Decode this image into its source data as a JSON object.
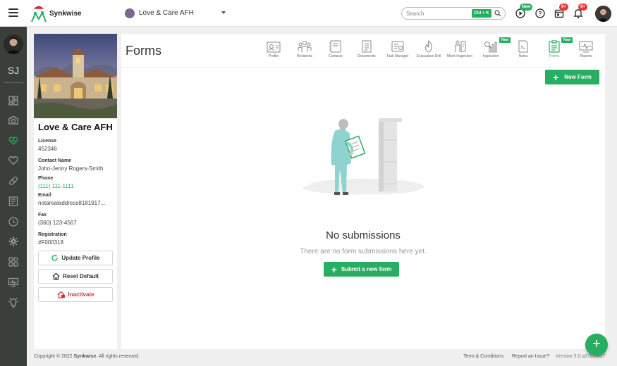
{
  "app": {
    "brand": "Synkwise"
  },
  "header": {
    "home_selector": "Love & Care AFH",
    "search": {
      "placeholder": "Search",
      "shortcut": "Ctrl + K"
    },
    "play_badge": "New",
    "calendar_badge": "9+",
    "bell_badge": "9+"
  },
  "sidebar": {
    "initials": "SJ",
    "icons": [
      "dashboard-icon",
      "camera-icon",
      "heart-hand-icon",
      "heart-icon",
      "pill-icon",
      "report-icon",
      "clock-icon",
      "gear-icon",
      "apps-icon",
      "monitor-icon",
      "bulb-icon"
    ]
  },
  "profile": {
    "name": "Love & Care AFH",
    "fields": [
      {
        "label": "License",
        "value": "452346"
      },
      {
        "label": "Contact Name",
        "value": "John-Jenny Rogers-Smith"
      },
      {
        "label": "Phone",
        "value": "(111) 111-1111"
      },
      {
        "label": "Email",
        "value": "notarealaddress8181917..."
      },
      {
        "label": "Fax",
        "value": "(360) 123-4567"
      },
      {
        "label": "Registration",
        "value": "#F000318"
      }
    ],
    "buttons": {
      "update": "Update Profile",
      "reset": "Reset Default",
      "inactivate": "Inactivate"
    }
  },
  "main": {
    "title": "Forms",
    "tabs": [
      {
        "label": "Profile"
      },
      {
        "label": "Residents"
      },
      {
        "label": "Contacts"
      },
      {
        "label": "Documents"
      },
      {
        "label": "Task Manager"
      },
      {
        "label": "Evacuation Drill"
      },
      {
        "label": "Mock Inspection"
      },
      {
        "label": "Inspection",
        "badge": "New"
      },
      {
        "label": "Notes"
      },
      {
        "label": "Forms",
        "badge": "New",
        "active": true
      },
      {
        "label": "Reports"
      }
    ],
    "new_form_button": "New Form",
    "empty": {
      "title": "No submissions",
      "subtitle": "There are no form submissions here yet.",
      "button": "Submit a new form"
    }
  },
  "footer": {
    "copyright_prefix": "Copyright © 2022",
    "copyright_brand": "Synkwise",
    "copyright_suffix": ". All rights reserved.",
    "terms": "Term & Conditions",
    "report": "Report an Issue?",
    "version": "Version 3.0.a278fa4a7"
  },
  "colors": {
    "accent": "#27ae60",
    "sidebar": "#3a3f3b",
    "danger": "#d32f2f"
  }
}
